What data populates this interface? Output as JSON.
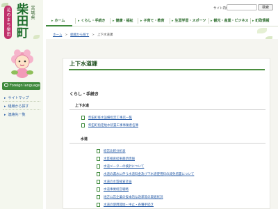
{
  "logo": {
    "prefecture": "宮城県",
    "town": "柴田町",
    "catchphrase": "花のまち柴田"
  },
  "header": {
    "site_map_label": "サイト内検索",
    "search_placeholder": "",
    "search_button": "検索"
  },
  "nav": [
    {
      "label": "ホーム"
    },
    {
      "label": "くらし・手続き"
    },
    {
      "label": "健康・福祉"
    },
    {
      "label": "子育て・教育"
    },
    {
      "label": "生涯学習・スポーツ"
    },
    {
      "label": "観光・産業・ビジネス"
    },
    {
      "label": "町政情報"
    }
  ],
  "sidebar": {
    "foreign_language": "Foreign language",
    "links": [
      {
        "label": "サイトマップ"
      },
      {
        "label": "組織から探す"
      },
      {
        "label": "連絡先一覧"
      }
    ]
  },
  "breadcrumb": {
    "items": [
      "ホーム",
      "組織から探す",
      "上下水道課"
    ]
  },
  "page": {
    "title": "上下水道課",
    "section": "くらし・手続き",
    "groups": [
      {
        "heading": "上下水道",
        "links": [
          "柴田町排水設備指定工事店一覧",
          "柴田町指定給水装置工事事業者名簿"
        ]
      },
      {
        "heading": "水道",
        "links": [
          "経営比較分析表",
          "水質検査結果最新情報",
          "水道メーターの検針について",
          "水道の漏水に伴う水道料金及び下水道使用料の減免措置について",
          "水道の水質検査計画",
          "水道事業経営戦略",
          "地方公営企業の抜本的な改革等の取組状況",
          "水道の使用開始・中止・各種手続き"
        ]
      }
    ]
  },
  "colors": {
    "accent_green": "#3f8a3c",
    "title_green": "#1e4f1e",
    "link_blue": "#2a5ea8",
    "catch_pink": "#c0306a"
  }
}
